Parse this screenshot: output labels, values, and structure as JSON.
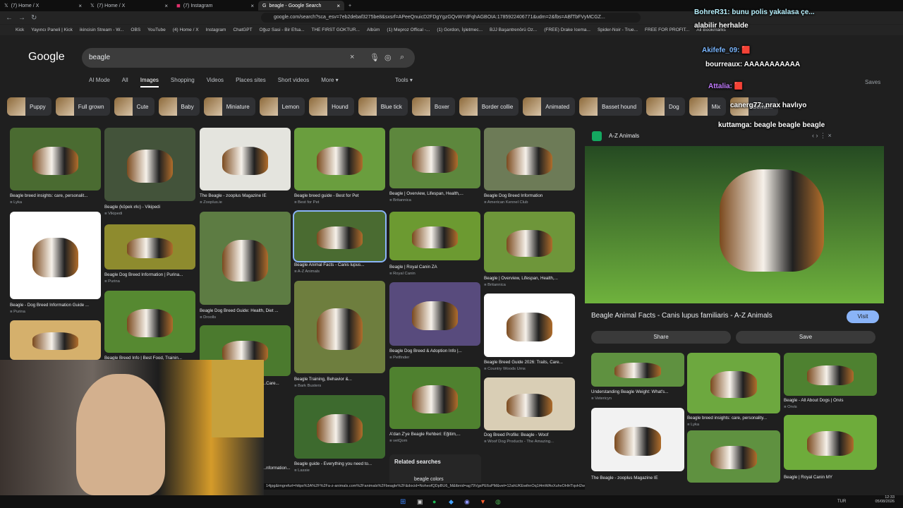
{
  "browser": {
    "tabs": [
      "(7) Home / X",
      "(7) Home / X",
      "(7) Instagram",
      "beagle - Google Search"
    ],
    "url": "google.com/search?sca_esv=7eb2debaf3275be8&sxsrf=APeeQnuicD2FDgYgzGQvWYdFqhAGBOIA:1785922406771&udm=2&fbs=ABfTbFVyMCGZ...",
    "bookmarks": [
      "Kick",
      "Yayıncı Paneli | Kick",
      "ikincisin Stream - W...",
      "OBS",
      "YouTube",
      "(4) Home / X",
      "Instagram",
      "ChatGPT",
      "Oğuz Sasi - Bir Efsa...",
      "THE FIRST GOKTUR...",
      "Albüm",
      "(1) Meproz Offical -...",
      "(1) Gordon, İşletmec...",
      "BJJ Başantrenörü Oz...",
      "(FREE) Drake Icema...",
      "Spider-Noir - True...",
      "FREE FOR PROFIT...",
      "All Bookmarks"
    ]
  },
  "google": {
    "logo": "Google",
    "query": "beagle",
    "filters": [
      "AI Mode",
      "All",
      "Images",
      "Shopping",
      "Videos",
      "Places sites",
      "Short videos",
      "More ▾"
    ],
    "tools": "Tools ▾",
    "saves": "Saves",
    "chips": [
      "Puppy",
      "Full grown",
      "Cute",
      "Baby",
      "Miniature",
      "Lemon",
      "Hound",
      "Blue tick",
      "Boxer",
      "Border collie",
      "Animated",
      "Basset hound",
      "Dog",
      "Mix",
      "Berne..."
    ]
  },
  "results": [
    {
      "caption": "Beagle breed insights: care, personalit...",
      "source": "Lyka"
    },
    {
      "caption": "Beagle (köpek ırkı) - Vikipedi",
      "source": "Vikipedi"
    },
    {
      "caption": "The Beagle - zooplus Magazine IE",
      "source": "Zooplus.ie"
    },
    {
      "caption": "Beagle breed guide - Best for Pet",
      "source": "Best for Pet"
    },
    {
      "caption": "Beagle | Overview, Lifespan, Health,...",
      "source": "Britannica"
    },
    {
      "caption": "Beagle Dog Breed Information",
      "source": "American Kennel Club"
    },
    {
      "caption": "Beagle - Dog Breed Information Guide ...",
      "source": "Purina"
    },
    {
      "caption": "Beagle Dog Breed Information | Purina...",
      "source": "Purina"
    },
    {
      "caption": "Beagle Animal Facts - Canis lupus...",
      "source": "A-Z Animals"
    },
    {
      "caption": "Beagle | Royal Canin ZA",
      "source": "Royal Canin"
    },
    {
      "caption": "Beagle | Overview, Lifespan, Health,...",
      "source": "Britannica"
    },
    {
      "caption": "Beagle Dog Breed Guide: Health, Diet ...",
      "source": "Droolls"
    },
    {
      "caption": "Beagle Dog Breed & Adoption Info |...",
      "source": "Petfinder"
    },
    {
      "caption": "Beagle Breed Guide 2026: Traits, Care...",
      "source": "Country Woods Urns"
    },
    {
      "caption": "Beagle Training, Behavior &...",
      "source": "Bark Busters"
    },
    {
      "caption": "A'dan Z'ye Beagle Rehberi: Eğitim,...",
      "source": "vetQom"
    },
    {
      "caption": "Dog Breed Profile: Beagle - Woof",
      "source": "Woof Dog Products - The Amazing..."
    },
    {
      "caption": "Beagle guide - Everything you need to...",
      "source": "Lassie"
    },
    {
      "caption": "Beagle Breed Info | Best Food, Trainin...",
      "source": ""
    },
    {
      "caption": "...Care...",
      "source": ""
    },
    {
      "caption": "...nformation...",
      "source": ""
    }
  ],
  "related": {
    "title": "Related searches",
    "item": "beagle colors"
  },
  "preview": {
    "site": "A-Z Animals",
    "title": "Beagle Animal Facts - Canis lupus familiaris - A-Z Animals",
    "visit": "Visit",
    "share": "Share",
    "save": "Save",
    "related": [
      {
        "caption": "Understanding Beagle Weight: What's...",
        "source": "Vetericyn"
      },
      {
        "caption": "Beagle breed insights: care, personality...",
        "source": "Lyka"
      },
      {
        "caption": "Beagle - All About Dogs | Orvis",
        "source": "Orvis"
      },
      {
        "caption": "The Beagle - zooplus Magazine IE",
        "source": "Zooplus.ie"
      },
      {
        "caption": "",
        "source": ""
      },
      {
        "caption": "Beagle | Royal Canin MY",
        "source": ""
      }
    ]
  },
  "chat": [
    {
      "user": "BohreR31:",
      "text": "bunu polis yakalasa çe..."
    },
    {
      "user": "",
      "text": "alabilir herhalde"
    },
    {
      "user": "Akifefe_09:",
      "text": "🟥"
    },
    {
      "user": "bourreaux:",
      "text": "AAAAAAAAAAA"
    },
    {
      "user": "Attalia:",
      "text": "🟥"
    },
    {
      "user": "canerg77:",
      "text": "nrax havlıyo"
    },
    {
      "user": "kuttamga:",
      "text": "beagle beagle beagle"
    }
  ],
  "status_url": "14jpg&imgrefurl=https%3A%2F%2Fa-z-animals.com%2Fanimals%2Fbeagle%2F&docid=NoheofQDpBU6_M&tbnid=ag79VgsPE6uPM&vet=12ahUKEwihnOq1l4mWAxXuhvOHHTqvH2wQnPAOegQIzwMQAA..",
  "taskbar": {
    "language": "TUR",
    "time": "12:33",
    "date": "05/08/2026"
  }
}
